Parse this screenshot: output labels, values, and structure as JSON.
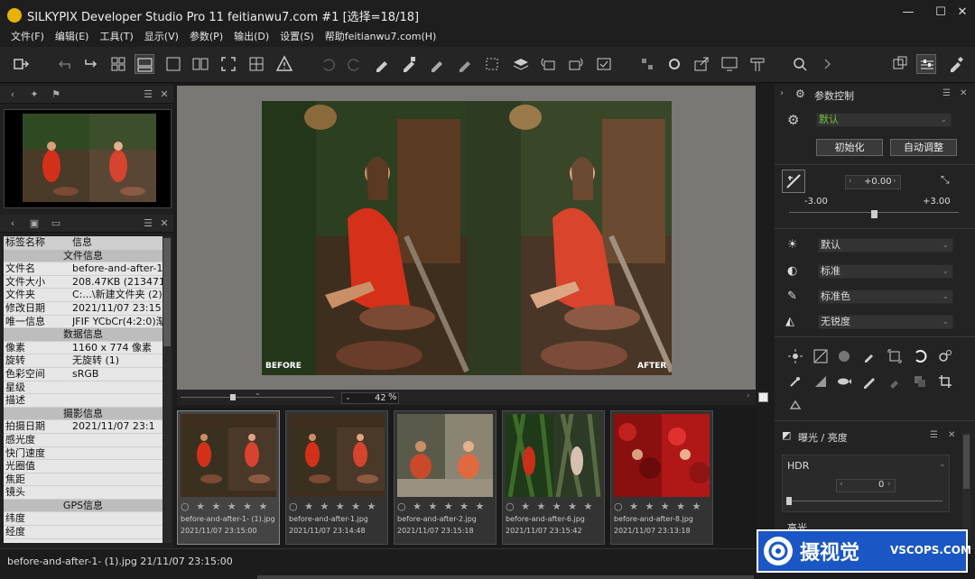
{
  "window": {
    "title": "SILKYPIX Developer Studio Pro 11 feitianwu7.com    #1   [选择=18/18]",
    "controls": [
      "—",
      "☐",
      "✕"
    ]
  },
  "menu": [
    "文件(F)",
    "编辑(E)",
    "工具(T)",
    "显示(V)",
    "参数(P)",
    "输出(D)",
    "设置(S)",
    "帮助feitianwu7.com(H)"
  ],
  "left_panel": {
    "info_header_col1": "标签名称",
    "info_header_col2": "信息",
    "sections": {
      "file": "文件信息",
      "data": "数据信息",
      "shoot": "摄影信息",
      "gps": "GPS信息"
    },
    "rows_file": [
      {
        "k": "文件名",
        "v": "before-and-after-1"
      },
      {
        "k": "文件大小",
        "v": "208.47KB (213471B"
      },
      {
        "k": "文件夹",
        "v": "C:...\\新建文件夹 (2)"
      },
      {
        "k": "修改日期",
        "v": "2021/11/07 23:15:0"
      },
      {
        "k": "唯一信息",
        "v": "JFIF YCbCr(4:2:0)渐"
      }
    ],
    "rows_data": [
      {
        "k": "像素",
        "v": "1160 x 774 像素"
      },
      {
        "k": "旋转",
        "v": "无旋转 (1)"
      },
      {
        "k": "色彩空间",
        "v": "sRGB"
      },
      {
        "k": "星级",
        "v": ""
      },
      {
        "k": "描述",
        "v": ""
      }
    ],
    "rows_shoot": [
      {
        "k": "拍摄日期",
        "v": "2021/11/07 23:1"
      },
      {
        "k": "感光度",
        "v": ""
      },
      {
        "k": "快门速度",
        "v": ""
      },
      {
        "k": "光圈值",
        "v": ""
      },
      {
        "k": "焦距",
        "v": ""
      },
      {
        "k": "镜头",
        "v": ""
      }
    ],
    "rows_gps": [
      {
        "k": "纬度",
        "v": ""
      },
      {
        "k": "经度",
        "v": ""
      }
    ]
  },
  "preview": {
    "before_label": "BEFORE",
    "after_label": "AFTER",
    "zoom_value": "42",
    "zoom_unit": "%"
  },
  "filmstrip": [
    {
      "name": "before-and-after-1- (1).jpg",
      "date": "2021/11/07 23:15:00",
      "stars": "○ ★ ★ ★ ★ ★",
      "selected": true
    },
    {
      "name": "before-and-after-1.jpg",
      "date": "2021/11/07 23:14:48",
      "stars": "○ ★ ★ ★ ★ ★",
      "selected": false
    },
    {
      "name": "before-and-after-2.jpg",
      "date": "2021/11/07 23:15:18",
      "stars": "○ ★ ★ ★ ★ ★",
      "selected": false
    },
    {
      "name": "before-and-after-6.jpg",
      "date": "2021/11/07 23:15:42",
      "stars": "○ ★ ★ ★ ★ ★",
      "selected": false
    },
    {
      "name": "before-and-after-8.jpg",
      "date": "2021/11/07 23:13:18",
      "stars": "○ ★ ★ ★ ★ ★",
      "selected": false
    }
  ],
  "right_panel": {
    "title": "参数控制",
    "preset": "默认",
    "init_button": "初始化",
    "auto_button": "自动调整",
    "exposure_value": "+0.00",
    "exposure_min": "-3.00",
    "exposure_max": "+3.00",
    "exposure_level": 0.5,
    "wb_preset": "默认",
    "tone_preset": "标准",
    "color_preset": "标准色",
    "sharp_preset": "无锐度",
    "sub_panel_title": "曝光 / 亮度",
    "hdr_label": "HDR",
    "hdr_value": "0",
    "highlight_label": "高光"
  },
  "status_text": "before-and-after-1- (1).jpg 21/11/07 23:15:00",
  "watermark": {
    "cn": "摄视觉",
    "en": "VSCOPS.COM"
  }
}
